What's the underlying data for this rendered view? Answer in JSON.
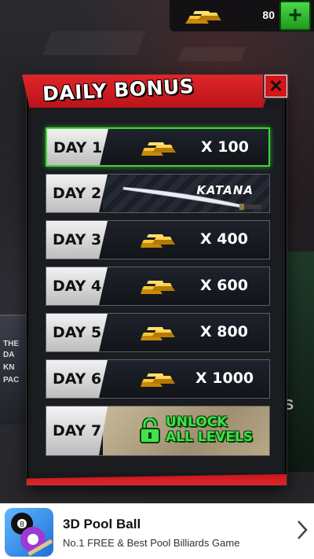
{
  "topbar": {
    "currency_amount": "80",
    "add_label": "+"
  },
  "modal": {
    "title": "DAILY BONUS",
    "close_label": "✕"
  },
  "days": [
    {
      "label": "DAY 1",
      "reward": "X 100",
      "type": "gold",
      "state": "active"
    },
    {
      "label": "DAY 2",
      "reward": "KATANA",
      "type": "item",
      "state": "normal"
    },
    {
      "label": "DAY 3",
      "reward": "X 400",
      "type": "gold",
      "state": "normal"
    },
    {
      "label": "DAY 4",
      "reward": "X 600",
      "type": "gold",
      "state": "normal"
    },
    {
      "label": "DAY 5",
      "reward": "X 800",
      "type": "gold",
      "state": "normal"
    },
    {
      "label": "DAY 6",
      "reward": "X 1000",
      "type": "gold",
      "state": "normal"
    },
    {
      "label": "DAY 7",
      "reward_line1": "UNLOCK",
      "reward_line2": "ALL LEVELS",
      "type": "unlock",
      "state": "normal"
    }
  ],
  "ad": {
    "title": "3D Pool Ball",
    "subtitle": "No.1 FREE & Best Pool Billiards Game"
  },
  "colors": {
    "accent_red": "#d4161b",
    "accent_green": "#3fd33c",
    "gold": "#f1b416"
  },
  "icons": [
    "gold-bars-icon",
    "plus-icon",
    "close-icon",
    "katana-icon",
    "lock-icon",
    "chevron-right-icon",
    "pool-ball-icon"
  ]
}
